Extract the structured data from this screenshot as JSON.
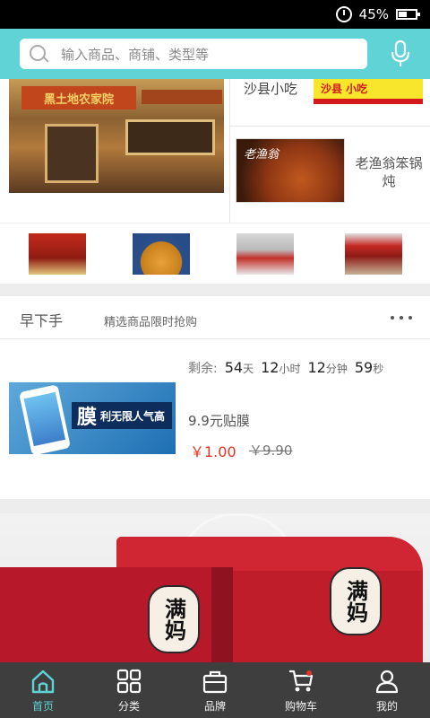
{
  "status_bar": {
    "battery_text": "45%"
  },
  "search": {
    "placeholder": "输入商品、商铺、类型等"
  },
  "stores": {
    "store_1_name": "沙县小吃",
    "store_1_logo_text": "沙县 小吃",
    "store_2_name": "老渔翁笨锅炖",
    "store_2_image_text": "老渔翁",
    "main_sign_text": "黑土地农家院"
  },
  "flash_sale": {
    "title": "早下手",
    "subtitle": "精选商品限时抢购",
    "countdown_label": "剩余:",
    "days": "54",
    "days_unit": "天",
    "hours": "12",
    "hours_unit": "小时",
    "minutes": "12",
    "minutes_unit": "分钟",
    "seconds": "59",
    "seconds_unit": "秒",
    "product_name": "9.9元贴膜",
    "price": "￥1.00",
    "old_price": "￥9.90",
    "product_image_big_char": "膜",
    "product_image_text": "利无限人气高"
  },
  "banner": {
    "seal_text": "满妈"
  },
  "nav": [
    {
      "label": "首页",
      "icon": "home-icon",
      "active": true
    },
    {
      "label": "分类",
      "icon": "grid-icon",
      "active": false
    },
    {
      "label": "品牌",
      "icon": "bag-icon",
      "active": false
    },
    {
      "label": "购物车",
      "icon": "cart-icon",
      "active": false
    },
    {
      "label": "我的",
      "icon": "user-icon",
      "active": false
    }
  ],
  "colors": {
    "accent": "#5fd3d6",
    "price": "#e53326",
    "nav_bg": "#3e3e3e"
  }
}
